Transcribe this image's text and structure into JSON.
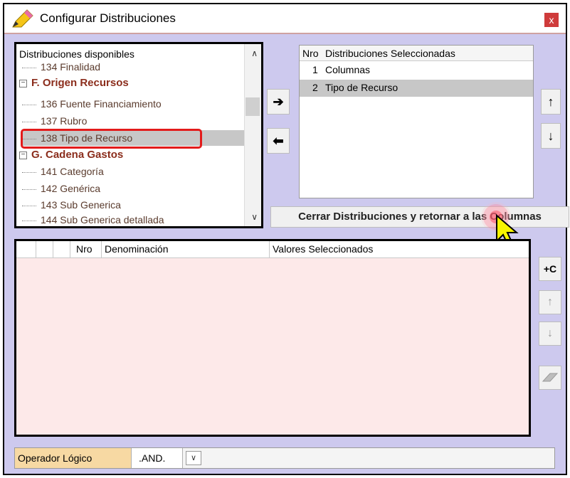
{
  "window": {
    "title": "Configurar Distribuciones",
    "close_label": "x"
  },
  "available": {
    "header": "Distribuciones disponibles",
    "items": [
      {
        "label": "134 Finalidad",
        "type": "item"
      },
      {
        "label": "F. Origen Recursos",
        "type": "group"
      },
      {
        "label": "136 Fuente Financiamiento",
        "type": "item"
      },
      {
        "label": "137 Rubro",
        "type": "item"
      },
      {
        "label": "138 Tipo de Recurso",
        "type": "item",
        "selected": true
      },
      {
        "label": "G. Cadena Gastos",
        "type": "group"
      },
      {
        "label": "141 Categoría",
        "type": "item"
      },
      {
        "label": "142 Genérica",
        "type": "item"
      },
      {
        "label": "143 Sub Generica",
        "type": "item"
      },
      {
        "label": "144 Sub Generica detallada",
        "type": "item"
      }
    ]
  },
  "selected": {
    "col_nro": "Nro",
    "col_name": "Distribuciones Seleccionadas",
    "rows": [
      {
        "nro": "1",
        "name": "Columnas"
      },
      {
        "nro": "2",
        "name": "Tipo de Recurso"
      }
    ]
  },
  "buttons": {
    "add": "➔",
    "remove": "⬅",
    "up": "↑",
    "down": "↓",
    "close_dist": "Cerrar Distribuciones y retornar a las Columnas",
    "add_col": "+C",
    "grid_up": "↑",
    "grid_down": "↓"
  },
  "grid": {
    "col_nro": "Nro",
    "col_denom": "Denominación",
    "col_values": "Valores Seleccionados"
  },
  "operator": {
    "label": "Operador Lógico",
    "value": ".AND.",
    "dropdown_icon": "chevron-down-icon"
  }
}
